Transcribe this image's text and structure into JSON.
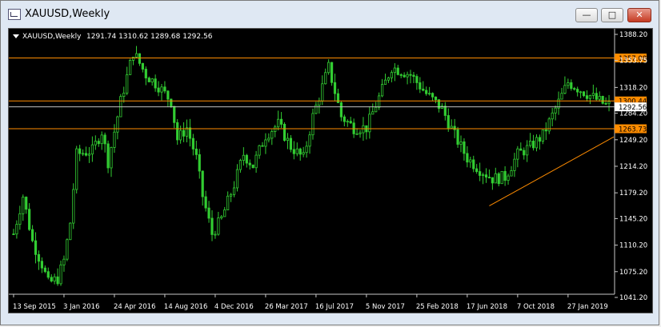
{
  "window": {
    "title": "XAUUSD,Weekly",
    "buttons": {
      "minimize": "—",
      "maximize": "□",
      "close": "✕"
    }
  },
  "chart_header": {
    "symbol": "XAUUSD,Weekly",
    "ohlc": "1291.74 1310.62 1289.68 1292.56"
  },
  "chart_data": {
    "type": "candlestick",
    "symbol": "XAUUSD",
    "timeframe": "Weekly",
    "bid_line": 1292.56,
    "ylim": [
      1041.21,
      1388.2
    ],
    "y_ticks": [
      "1388.20",
      "1353.75",
      "1318.20",
      "1284.20",
      "1249.20",
      "1214.20",
      "1179.20",
      "1145.20",
      "1110.20",
      "1075.20",
      "1041.20"
    ],
    "x_ticks": [
      "13 Sep 2015",
      "3 Jan 2016",
      "24 Apr 2016",
      "14 Aug 2016",
      "4 Dec 2016",
      "26 Mar 2017",
      "16 Jul 2017",
      "5 Nov 2017",
      "25 Feb 2018",
      "17 Jun 2018",
      "7 Oct 2018",
      "27 Jan 2019"
    ],
    "x_tick_weeks": [
      0,
      16,
      32,
      48,
      64,
      80,
      96,
      112,
      128,
      144,
      160,
      176
    ],
    "levels": [
      {
        "label": "1357.08",
        "value": 1357.08,
        "color": "#ff8c00"
      },
      {
        "label": "1300.44",
        "value": 1300.44,
        "color": "#ff8c00"
      },
      {
        "label": "1263.73",
        "value": 1263.73,
        "color": "#ff8c00"
      }
    ],
    "trendline": {
      "from_week": 151,
      "from_price": 1162,
      "to_week": 189,
      "to_price": 1253,
      "color": "#ff8c00"
    },
    "close_path": [
      [
        0,
        1125
      ],
      [
        3,
        1175
      ],
      [
        6,
        1115
      ],
      [
        9,
        1085
      ],
      [
        11,
        1060
      ],
      [
        14,
        1066
      ],
      [
        16,
        1090
      ],
      [
        18,
        1140
      ],
      [
        20,
        1230
      ],
      [
        25,
        1235
      ],
      [
        28,
        1260
      ],
      [
        30,
        1220
      ],
      [
        34,
        1300
      ],
      [
        38,
        1365
      ],
      [
        42,
        1335
      ],
      [
        46,
        1320
      ],
      [
        50,
        1300
      ],
      [
        52,
        1250
      ],
      [
        55,
        1265
      ],
      [
        58,
        1225
      ],
      [
        60,
        1175
      ],
      [
        63,
        1125
      ],
      [
        66,
        1145
      ],
      [
        70,
        1190
      ],
      [
        73,
        1230
      ],
      [
        76,
        1215
      ],
      [
        80,
        1255
      ],
      [
        84,
        1270
      ],
      [
        88,
        1240
      ],
      [
        92,
        1225
      ],
      [
        95,
        1280
      ],
      [
        100,
        1345
      ],
      [
        104,
        1280
      ],
      [
        108,
        1265
      ],
      [
        112,
        1265
      ],
      [
        116,
        1305
      ],
      [
        120,
        1345
      ],
      [
        126,
        1335
      ],
      [
        131,
        1310
      ],
      [
        136,
        1290
      ],
      [
        140,
        1255
      ],
      [
        144,
        1225
      ],
      [
        148,
        1210
      ],
      [
        152,
        1198
      ],
      [
        156,
        1200
      ],
      [
        160,
        1230
      ],
      [
        164,
        1240
      ],
      [
        168,
        1255
      ],
      [
        172,
        1290
      ],
      [
        176,
        1325
      ],
      [
        180,
        1315
      ],
      [
        184,
        1305
      ],
      [
        188,
        1295
      ]
    ],
    "weeks": 190
  }
}
